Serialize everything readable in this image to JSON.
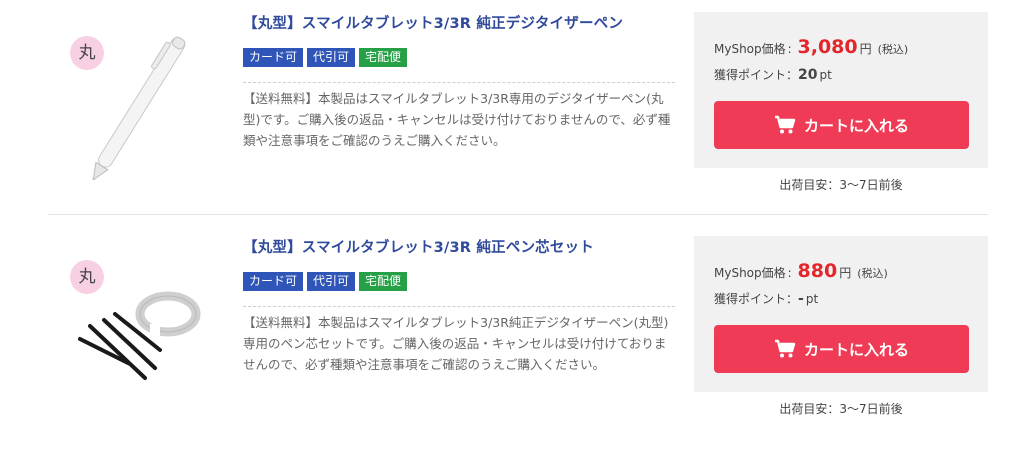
{
  "products": [
    {
      "badge": "丸",
      "title": "【丸型】スマイルタブレット3/3R 純正デジタイザーペン",
      "tags": [
        "カード可",
        "代引可",
        "宅配便"
      ],
      "description": "【送料無料】本製品はスマイルタブレット3/3R専用のデジタイザーペン(丸型)です。ご購入後の返品・キャンセルは受け付けておりませんので、必ず種類や注意事項をご確認のうえご購入ください。",
      "price_label": "MyShop価格",
      "price": "3,080",
      "yen": "円",
      "tax_note": "(税込)",
      "points_label": "獲得ポイント",
      "points_value": "20",
      "points_unit": "pt",
      "cart_label": "カートに入れる",
      "shipping": "出荷目安：3〜7日前後",
      "icon": "white-stylus-pen"
    },
    {
      "badge": "丸",
      "title": "【丸型】スマイルタブレット3/3R 純正ペン芯セット",
      "tags": [
        "カード可",
        "代引可",
        "宅配便"
      ],
      "description": "【送料無料】本製品はスマイルタブレット3/3R純正デジタイザーペン(丸型)専用のペン芯セットです。ご購入後の返品・キャンセルは受け付けておりませんので、必ず種類や注意事項をご確認のうえご購入ください。",
      "price_label": "MyShop価格",
      "price": "880",
      "yen": "円",
      "tax_note": "(税込)",
      "points_label": "獲得ポイント",
      "points_value": "-",
      "points_unit": "pt",
      "cart_label": "カートに入れる",
      "shipping": "出荷目安：3〜7日前後",
      "icon": "pen-nib-set"
    }
  ],
  "colors": {
    "title": "#2f4a9b",
    "price": "#e3262b",
    "cart_button": "#ef3b55",
    "tag_blue": "#2f55b8",
    "tag_green": "#25a046",
    "badge": "#f7d0e4"
  }
}
